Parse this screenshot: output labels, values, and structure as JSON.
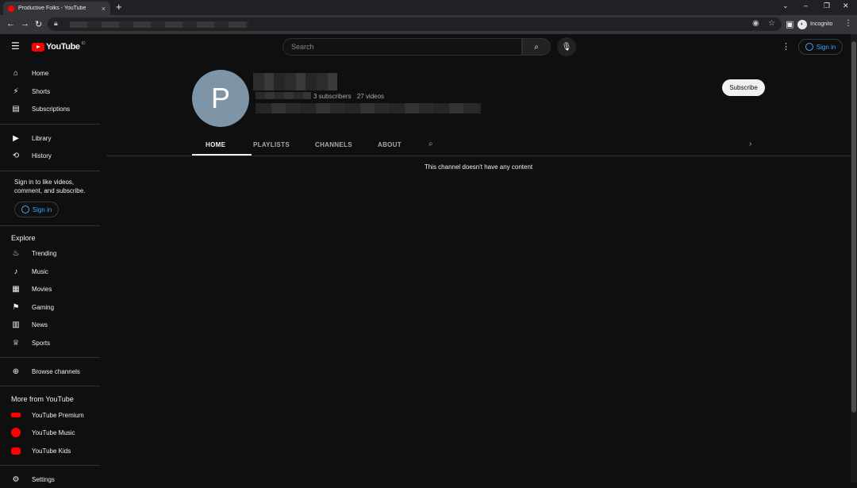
{
  "browser": {
    "tab_title": "Productive Folks - YouTube",
    "tab_close": "×",
    "new_tab": "+",
    "incognito_label": "Incognito"
  },
  "header": {
    "logo_text": "YouTube",
    "logo_sup": "ID",
    "search_placeholder": "Search",
    "signin_label": "Sign in"
  },
  "sidebar": {
    "main": [
      {
        "label": "Home",
        "icon": "home-icon",
        "glyph": "⌂"
      },
      {
        "label": "Shorts",
        "icon": "shorts-icon",
        "glyph": "⚡"
      },
      {
        "label": "Subscriptions",
        "icon": "subscriptions-icon",
        "glyph": "▤"
      }
    ],
    "library": [
      {
        "label": "Library",
        "icon": "library-icon",
        "glyph": "▶"
      },
      {
        "label": "History",
        "icon": "history-icon",
        "glyph": "⟲"
      }
    ],
    "signin_note": "Sign in to like videos, comment, and subscribe.",
    "signin_label": "Sign in",
    "explore_title": "Explore",
    "explore": [
      {
        "label": "Trending",
        "icon": "trending-icon",
        "glyph": "♨"
      },
      {
        "label": "Music",
        "icon": "music-icon",
        "glyph": "♪"
      },
      {
        "label": "Movies",
        "icon": "movies-icon",
        "glyph": "▦"
      },
      {
        "label": "Gaming",
        "icon": "gaming-icon",
        "glyph": "⚑"
      },
      {
        "label": "News",
        "icon": "news-icon",
        "glyph": "▥"
      },
      {
        "label": "Sports",
        "icon": "sports-icon",
        "glyph": "♕"
      }
    ],
    "browse_channels": "Browse channels",
    "more_title": "More from YouTube",
    "more": [
      {
        "label": "YouTube Premium",
        "icon": "youtube-premium-icon",
        "color": "#ff0000"
      },
      {
        "label": "YouTube Music",
        "icon": "youtube-music-icon",
        "color": "#ff0000"
      },
      {
        "label": "YouTube Kids",
        "icon": "youtube-kids-icon",
        "color": "#ff0000"
      }
    ],
    "settings": "Settings"
  },
  "channel": {
    "avatar_letter": "P",
    "subscribers": "3 subscribers",
    "videos": "27 videos",
    "subscribe_label": "Subscribe",
    "avatar_color": "#7d95a6"
  },
  "tabs": [
    {
      "label": "HOME",
      "active": true
    },
    {
      "label": "PLAYLISTS",
      "active": false
    },
    {
      "label": "CHANNELS",
      "active": false
    },
    {
      "label": "ABOUT",
      "active": false
    }
  ],
  "empty_message": "This channel doesn't have any content"
}
